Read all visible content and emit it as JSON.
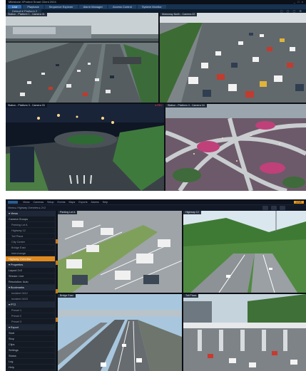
{
  "top_window": {
    "title": "Milestone XProtect Smart Client 2024",
    "window_controls": "_ □ ×",
    "tabs": [
      {
        "label": "Live",
        "active": true
      },
      {
        "label": "Playback",
        "active": false
      },
      {
        "label": "Sequence Explorer",
        "active": false
      },
      {
        "label": "Alarm Manager",
        "active": false
      },
      {
        "label": "Access Control",
        "active": false
      },
      {
        "label": "System Monitor",
        "active": false
      }
    ],
    "view_selector": "Default ▾ Platform 2",
    "toolbar_icons": "▢ ▢ ▢ ⚙",
    "cameras": [
      {
        "label": "Station - Platform 1 - Camera 01",
        "recording": ""
      },
      {
        "label": "Motorway North - Camera 02",
        "recording": ""
      },
      {
        "label": "Station - Platform 3 - Camera 03",
        "recording": "● REC"
      },
      {
        "label": "Station - Platform 4 - Camera 04",
        "recording": ""
      }
    ]
  },
  "bottom_window": {
    "menu": [
      "Views",
      "Cameras",
      "Setup",
      "Events",
      "Maps",
      "Exports",
      "Alarms",
      "Help"
    ],
    "badge": "LIVE",
    "toolbar_text": "Views  ▸  Highway Overview  ▸  2×2",
    "sidebar": [
      {
        "label": "▾ Views",
        "type": "head"
      },
      {
        "label": "Camera Groups",
        "type": "item"
      },
      {
        "label": "Parking Lot A",
        "type": "sub"
      },
      {
        "label": "Highway 12",
        "type": "sub"
      },
      {
        "label": "Toll Plaza",
        "type": "sub"
      },
      {
        "label": "City Center",
        "type": "sub"
      },
      {
        "label": "Bridge East",
        "type": "sub"
      },
      {
        "label": "Interchange",
        "type": "sub"
      },
      {
        "label": "Highway Overview",
        "type": "selected"
      },
      {
        "label": "▾ Properties",
        "type": "head"
      },
      {
        "label": "Layout 2×2",
        "type": "item"
      },
      {
        "label": "Stream: Live",
        "type": "item"
      },
      {
        "label": "Resolution: Auto",
        "type": "item"
      },
      {
        "label": "▾ Bookmarks",
        "type": "head"
      },
      {
        "label": "Incident 0412",
        "type": "sub"
      },
      {
        "label": "Incident 0415",
        "type": "sub"
      },
      {
        "label": "▾ PTZ",
        "type": "head"
      },
      {
        "label": "Preset 1",
        "type": "sub"
      },
      {
        "label": "Preset 2",
        "type": "sub"
      },
      {
        "label": "Preset 3",
        "type": "sub"
      },
      {
        "label": "▾ Export",
        "type": "head"
      },
      {
        "label": "Start",
        "type": "item"
      },
      {
        "label": "Stop",
        "type": "item"
      },
      {
        "label": "Clips",
        "type": "item"
      },
      {
        "label": "Settings",
        "type": "item"
      },
      {
        "label": "Status",
        "type": "item"
      },
      {
        "label": "Log",
        "type": "item"
      },
      {
        "label": "Help",
        "type": "item"
      }
    ],
    "cameras": [
      {
        "label": "Parking Lot A"
      },
      {
        "label": "Highway 12"
      },
      {
        "label": "Bridge East"
      },
      {
        "label": "Toll Plaza"
      }
    ]
  },
  "colors": {
    "accent_orange": "#e08a1e",
    "nav_blue": "#17324f",
    "active_tab": "#2f6bb0",
    "rec_red": "#ff4040"
  }
}
